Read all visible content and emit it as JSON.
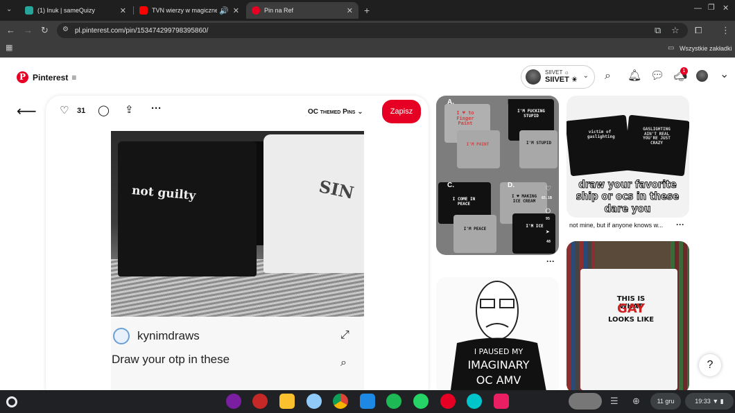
{
  "browser": {
    "tabs": [
      {
        "title": "(1) Inuk | sameQuizy",
        "color": "#26a69a"
      },
      {
        "title": "TVN wierzy w magiczne szt",
        "color": "#ff0000"
      },
      {
        "title": "Pin na Ref",
        "color": "#e60023"
      }
    ],
    "url": "pl.pinterest.com/pin/153474299798395860/",
    "bookmarks_label": "Wszystkie zakładki"
  },
  "header": {
    "logo_text": "Pinterest",
    "account_small": "SIIVET ☼",
    "account_name": "SIIVET ✬",
    "notification_count": "1"
  },
  "pin": {
    "likes": "31",
    "board_name": "OC themed Pins",
    "save_label": "Zapisz",
    "image_text_left": "not guilty",
    "image_text_right": "SIN",
    "author": "kynimdraws",
    "caption": "Draw your otp in these"
  },
  "related": {
    "pin1_letters": [
      "A.",
      "B.",
      "C.",
      "D."
    ],
    "pin1_shirts": [
      "I ♥ to Finger Paint",
      "I'M FUCKING STUPID",
      "I'M PAINT",
      "I'M STUPID",
      "I COME IN PEACE",
      "I ♥ MAKING ICE CREAM",
      "I'M PEACE",
      "I'M ICE"
    ],
    "pin1_side": [
      "65.1B",
      "95",
      "48"
    ],
    "pin2_shirts": [
      "victim of gaslighting",
      "GASLIGHTING AIN'T REAL YOU'RE JUST CRAZY"
    ],
    "pin2_overlay": "draw your favorite ship or ocs in these dare you",
    "pin2_desc": "not mine, but if anyone knows w...",
    "pin3_text": [
      "I PAUSED MY",
      "IMAGINARY",
      "OC AMV"
    ],
    "pin4_text": [
      "THIS IS WHAT",
      "GAY",
      "LOOKS LIKE"
    ]
  },
  "shelf": {
    "date": "11 gru",
    "time": "19:33"
  }
}
